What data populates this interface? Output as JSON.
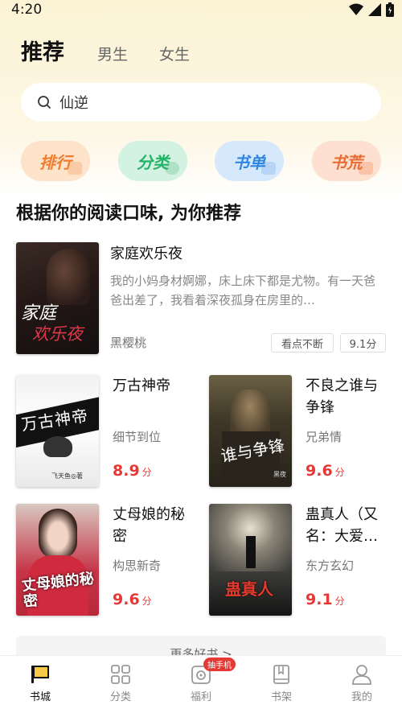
{
  "status_bar": {
    "time": "4:20"
  },
  "top_tabs": [
    "推荐",
    "男生",
    "女生"
  ],
  "search": {
    "text": "仙逆"
  },
  "categories": [
    {
      "label": "排行",
      "color": "#f07d2e",
      "bg": "#fde3c9"
    },
    {
      "label": "分类",
      "color": "#23b368",
      "bg": "#d4f2e1"
    },
    {
      "label": "书单",
      "color": "#2f86e0",
      "bg": "#d6e8fb"
    },
    {
      "label": "书荒",
      "color": "#e96b32",
      "bg": "#fde0cf"
    }
  ],
  "section_title": "根据你的阅读口味, 为你推荐",
  "featured": {
    "title": "家庭欢乐夜",
    "description": "我的小妈身材婀娜，床上床下都是尤物。有一天爸爸出差了，我看着深夜孤身在房里的…",
    "author": "黑樱桃",
    "tags": [
      "看点不断",
      "9.1分"
    ],
    "cover_text": [
      "家庭",
      "欢乐夜"
    ]
  },
  "books": [
    {
      "title": "万古神帝",
      "category": "细节到位",
      "score": "8.9",
      "unit": "分",
      "cover_text": "万古神帝",
      "cover_sub": "飞天鱼◎著"
    },
    {
      "title": "不良之谁与争锋",
      "category": "兄弟情",
      "score": "9.6",
      "unit": "分",
      "cover_text": "谁与争锋",
      "cover_sub": "黑夜"
    },
    {
      "title": "丈母娘的秘密",
      "category": "构思新奇",
      "score": "9.6",
      "unit": "分",
      "cover_text": "丈母娘的秘密"
    },
    {
      "title": "蛊真人（又名：大爱…",
      "category": "东方玄幻",
      "score": "9.1",
      "unit": "分",
      "cover_text": "蛊真人"
    }
  ],
  "more_button": "更多好书 >",
  "bottom_nav": [
    {
      "label": "书城",
      "icon": "flag-icon",
      "active": true
    },
    {
      "label": "分类",
      "icon": "grid-icon",
      "active": false
    },
    {
      "label": "福利",
      "icon": "gift-icon",
      "active": false,
      "badge": "抽手机"
    },
    {
      "label": "书架",
      "icon": "bookshelf-icon",
      "active": false
    },
    {
      "label": "我的",
      "icon": "user-icon",
      "active": false
    }
  ]
}
